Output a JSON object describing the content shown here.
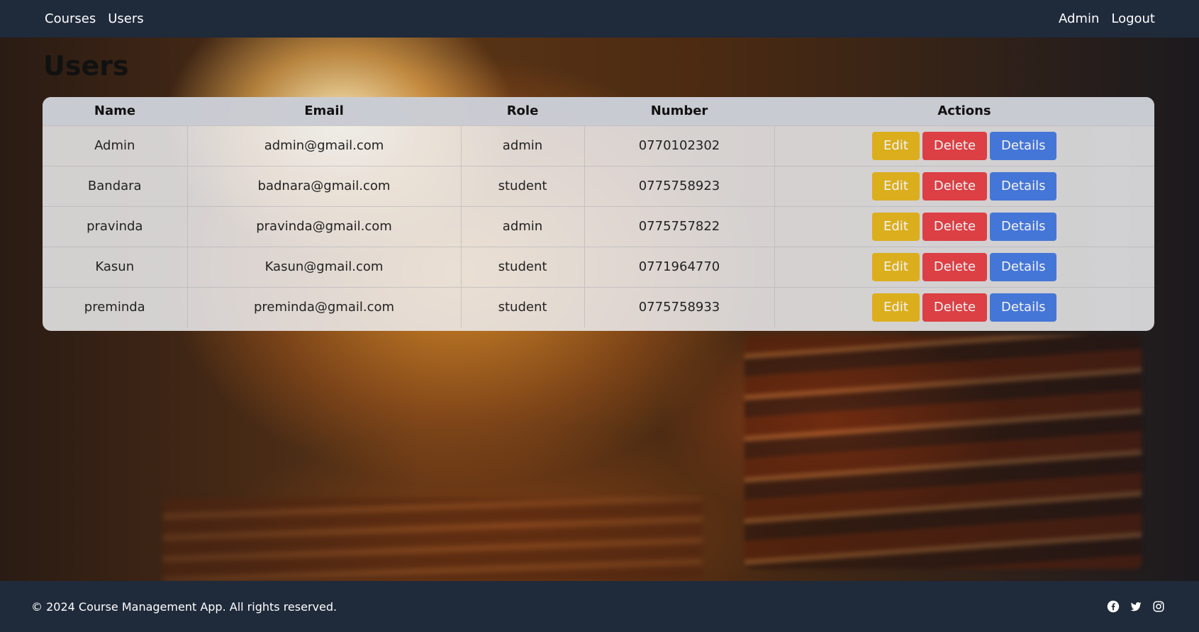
{
  "nav": {
    "left": [
      "Courses",
      "Users"
    ],
    "right": [
      "Admin",
      "Logout"
    ]
  },
  "page_title": "Users",
  "table": {
    "headers": [
      "Name",
      "Email",
      "Role",
      "Number",
      "Actions"
    ],
    "rows": [
      {
        "name": "Admin",
        "email": "admin@gmail.com",
        "role": "admin",
        "number": "0770102302"
      },
      {
        "name": "Bandara",
        "email": "badnara@gmail.com",
        "role": "student",
        "number": "0775758923"
      },
      {
        "name": "pravinda",
        "email": "pravinda@gmail.com",
        "role": "admin",
        "number": "0775757822"
      },
      {
        "name": "Kasun",
        "email": "Kasun@gmail.com",
        "role": "student",
        "number": "0771964770"
      },
      {
        "name": "preminda",
        "email": "preminda@gmail.com",
        "role": "student",
        "number": "0775758933"
      }
    ],
    "actions": {
      "edit": "Edit",
      "delete": "Delete",
      "details": "Details"
    }
  },
  "footer": {
    "copyright": "© 2024 Course Management App. All rights reserved.",
    "social_icons": [
      "facebook-icon",
      "twitter-icon",
      "instagram-icon"
    ]
  },
  "colors": {
    "navbar": "#1f2a3b",
    "edit": "#dcaa0a",
    "delete": "#dc3237",
    "details": "#376ed7"
  }
}
